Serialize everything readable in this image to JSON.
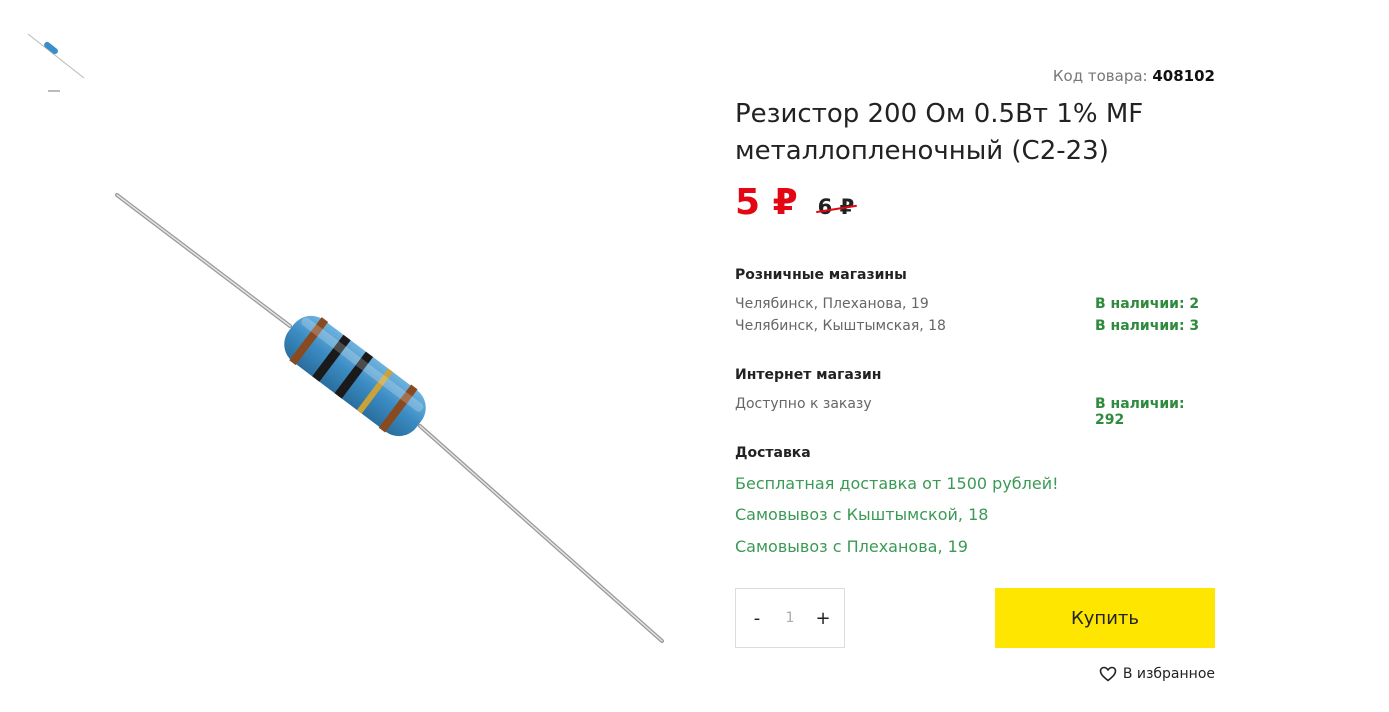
{
  "product": {
    "sku_label": "Код товара:",
    "sku_value": "408102",
    "title": "Резистор 200 Ом 0.5Вт 1% MF металлопленочный (С2-23)",
    "price_new": "5 ₽",
    "price_old": "6 ₽"
  },
  "retail": {
    "title": "Розничные магазины",
    "stores": [
      {
        "address": "Челябинск, Плеханова, 19",
        "stock": "В наличии: 2"
      },
      {
        "address": "Челябинск, Кыштымская, 18",
        "stock": "В наличии: 3"
      }
    ]
  },
  "online": {
    "title": "Интернет магазин",
    "label": "Доступно к заказу",
    "stock": "В наличии: 292"
  },
  "delivery": {
    "title": "Доставка",
    "options": [
      "Бесплатная доставка от 1500 рублей!",
      "Самовывоз с Кыштымской, 18",
      "Самовывоз с Плеханова, 19"
    ]
  },
  "purchase": {
    "minus": "-",
    "plus": "+",
    "quantity": "1",
    "buy_label": "Купить",
    "favorite_label": "В избранное"
  },
  "colors": {
    "price_red": "#e30613",
    "stock_green": "#2e8b3e",
    "link_green": "#3a9a55",
    "buy_yellow": "#ffe600"
  },
  "icons": {
    "favorite": "heart-icon",
    "thumbnail": "resistor-thumbnail",
    "main_image": "resistor-image"
  }
}
